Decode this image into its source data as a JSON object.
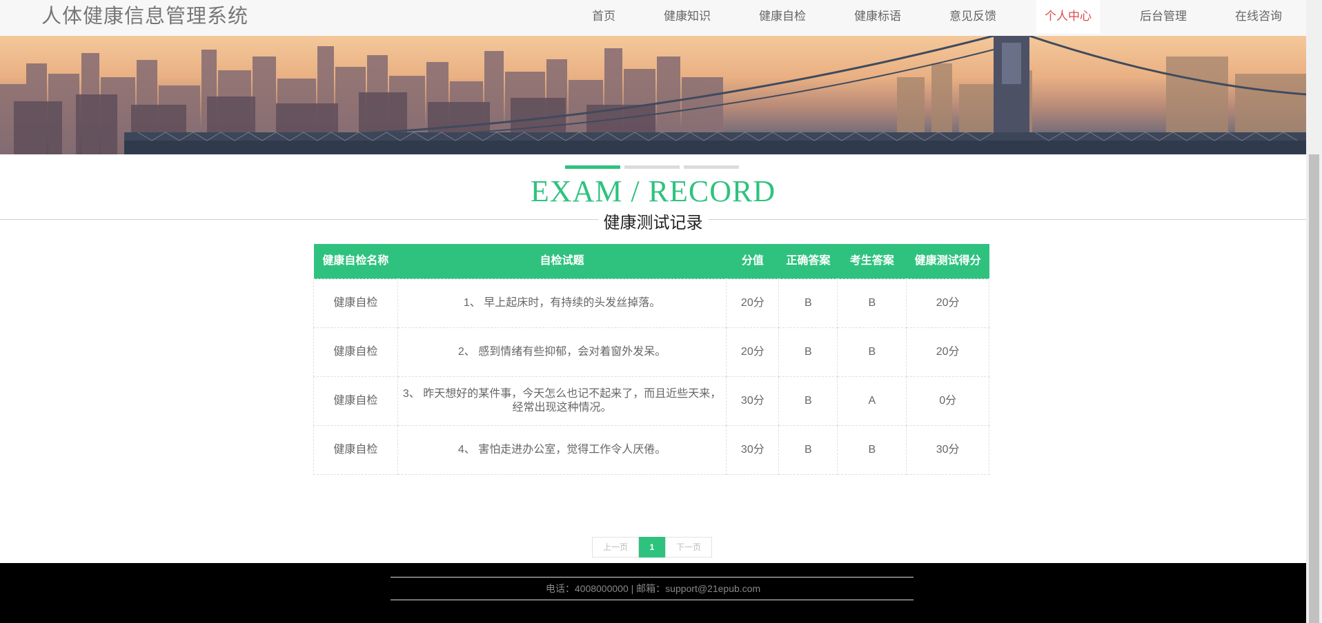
{
  "header": {
    "brand": "人体健康信息管理系统",
    "nav": [
      "首页",
      "健康知识",
      "健康自检",
      "健康标语",
      "意见反馈",
      "个人中心",
      "后台管理",
      "在线咨询"
    ],
    "active_index": 5
  },
  "section": {
    "title": "EXAM / RECORD",
    "subtitle": "健康测试记录"
  },
  "table": {
    "columns": [
      "健康自检名称",
      "自检试题",
      "分值",
      "正确答案",
      "考生答案",
      "健康测试得分"
    ],
    "rows": [
      [
        "健康自检",
        "1、 早上起床时，有持续的头发丝掉落。",
        "20分",
        "B",
        "B",
        "20分"
      ],
      [
        "健康自检",
        "2、 感到情绪有些抑郁，会对着窗外发呆。",
        "20分",
        "B",
        "B",
        "20分"
      ],
      [
        "健康自检",
        "3、 昨天想好的某件事，今天怎么也记不起来了，而且近些天来，经常出现这种情况。",
        "30分",
        "B",
        "A",
        "0分"
      ],
      [
        "健康自检",
        "4、 害怕走进办公室，觉得工作令人厌倦。",
        "30分",
        "B",
        "B",
        "30分"
      ]
    ]
  },
  "pagination": {
    "prev": "上一页",
    "current": "1",
    "next": "下一页"
  },
  "footer": {
    "contact": "电话：4008000000 | 邮箱：support@21epub.com"
  },
  "colors": {
    "accent": "#2fc27f",
    "active_nav": "#e04a4a",
    "footer_bg": "#000000"
  }
}
